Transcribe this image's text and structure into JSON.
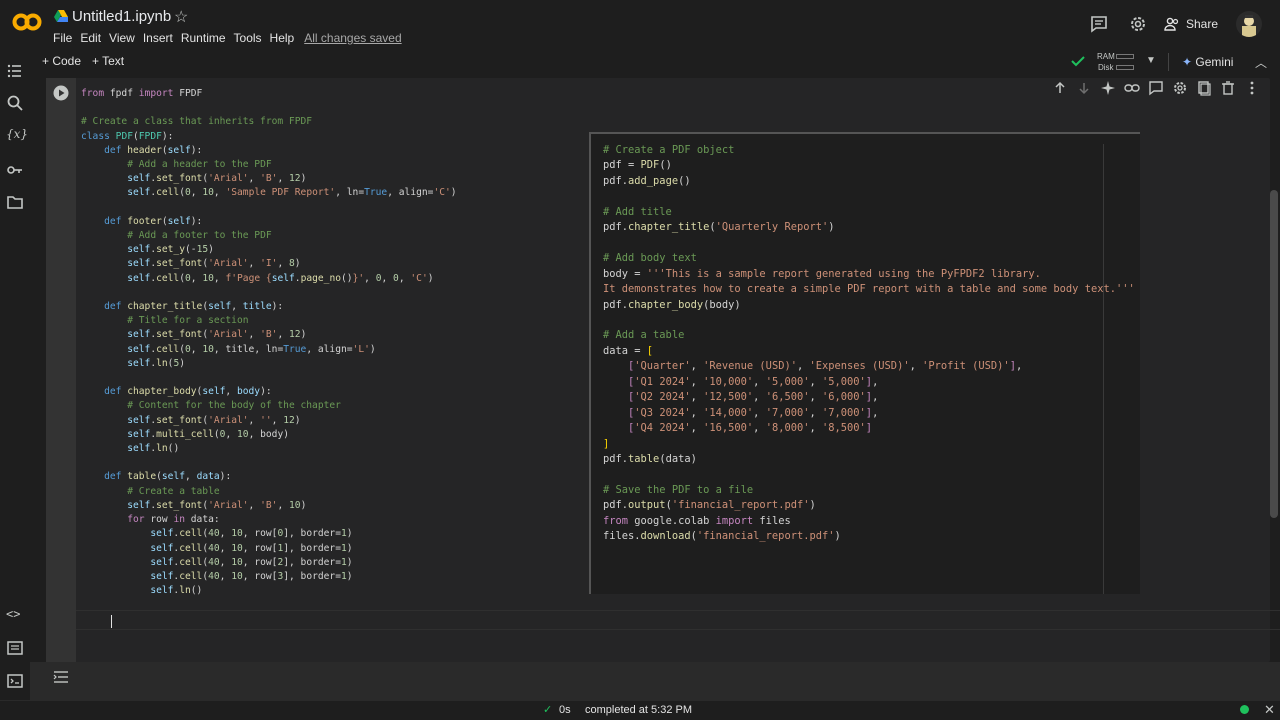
{
  "header": {
    "title": "Untitled1.ipynb",
    "menu": [
      "File",
      "Edit",
      "View",
      "Insert",
      "Runtime",
      "Tools",
      "Help"
    ],
    "saved_text": "All changes saved",
    "share_label": "Share"
  },
  "toolbar": {
    "add_code": "Code",
    "add_text": "Text",
    "ram_label": "RAM",
    "disk_label": "Disk",
    "gemini_label": "Gemini"
  },
  "status": {
    "duration": "0s",
    "completed": "completed at 5:32 PM"
  },
  "colors": {
    "accent": "#f9ab00",
    "success": "#1fc15d"
  }
}
